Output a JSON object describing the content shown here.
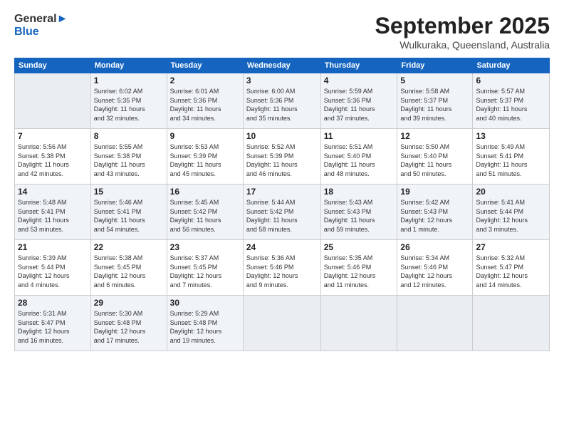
{
  "header": {
    "logo_line1": "General",
    "logo_line2": "Blue",
    "month": "September 2025",
    "location": "Wulkuraka, Queensland, Australia"
  },
  "weekdays": [
    "Sunday",
    "Monday",
    "Tuesday",
    "Wednesday",
    "Thursday",
    "Friday",
    "Saturday"
  ],
  "weeks": [
    [
      {
        "day": "",
        "info": ""
      },
      {
        "day": "1",
        "info": "Sunrise: 6:02 AM\nSunset: 5:35 PM\nDaylight: 11 hours\nand 32 minutes."
      },
      {
        "day": "2",
        "info": "Sunrise: 6:01 AM\nSunset: 5:36 PM\nDaylight: 11 hours\nand 34 minutes."
      },
      {
        "day": "3",
        "info": "Sunrise: 6:00 AM\nSunset: 5:36 PM\nDaylight: 11 hours\nand 35 minutes."
      },
      {
        "day": "4",
        "info": "Sunrise: 5:59 AM\nSunset: 5:36 PM\nDaylight: 11 hours\nand 37 minutes."
      },
      {
        "day": "5",
        "info": "Sunrise: 5:58 AM\nSunset: 5:37 PM\nDaylight: 11 hours\nand 39 minutes."
      },
      {
        "day": "6",
        "info": "Sunrise: 5:57 AM\nSunset: 5:37 PM\nDaylight: 11 hours\nand 40 minutes."
      }
    ],
    [
      {
        "day": "7",
        "info": "Sunrise: 5:56 AM\nSunset: 5:38 PM\nDaylight: 11 hours\nand 42 minutes."
      },
      {
        "day": "8",
        "info": "Sunrise: 5:55 AM\nSunset: 5:38 PM\nDaylight: 11 hours\nand 43 minutes."
      },
      {
        "day": "9",
        "info": "Sunrise: 5:53 AM\nSunset: 5:39 PM\nDaylight: 11 hours\nand 45 minutes."
      },
      {
        "day": "10",
        "info": "Sunrise: 5:52 AM\nSunset: 5:39 PM\nDaylight: 11 hours\nand 46 minutes."
      },
      {
        "day": "11",
        "info": "Sunrise: 5:51 AM\nSunset: 5:40 PM\nDaylight: 11 hours\nand 48 minutes."
      },
      {
        "day": "12",
        "info": "Sunrise: 5:50 AM\nSunset: 5:40 PM\nDaylight: 11 hours\nand 50 minutes."
      },
      {
        "day": "13",
        "info": "Sunrise: 5:49 AM\nSunset: 5:41 PM\nDaylight: 11 hours\nand 51 minutes."
      }
    ],
    [
      {
        "day": "14",
        "info": "Sunrise: 5:48 AM\nSunset: 5:41 PM\nDaylight: 11 hours\nand 53 minutes."
      },
      {
        "day": "15",
        "info": "Sunrise: 5:46 AM\nSunset: 5:41 PM\nDaylight: 11 hours\nand 54 minutes."
      },
      {
        "day": "16",
        "info": "Sunrise: 5:45 AM\nSunset: 5:42 PM\nDaylight: 11 hours\nand 56 minutes."
      },
      {
        "day": "17",
        "info": "Sunrise: 5:44 AM\nSunset: 5:42 PM\nDaylight: 11 hours\nand 58 minutes."
      },
      {
        "day": "18",
        "info": "Sunrise: 5:43 AM\nSunset: 5:43 PM\nDaylight: 11 hours\nand 59 minutes."
      },
      {
        "day": "19",
        "info": "Sunrise: 5:42 AM\nSunset: 5:43 PM\nDaylight: 12 hours\nand 1 minute."
      },
      {
        "day": "20",
        "info": "Sunrise: 5:41 AM\nSunset: 5:44 PM\nDaylight: 12 hours\nand 3 minutes."
      }
    ],
    [
      {
        "day": "21",
        "info": "Sunrise: 5:39 AM\nSunset: 5:44 PM\nDaylight: 12 hours\nand 4 minutes."
      },
      {
        "day": "22",
        "info": "Sunrise: 5:38 AM\nSunset: 5:45 PM\nDaylight: 12 hours\nand 6 minutes."
      },
      {
        "day": "23",
        "info": "Sunrise: 5:37 AM\nSunset: 5:45 PM\nDaylight: 12 hours\nand 7 minutes."
      },
      {
        "day": "24",
        "info": "Sunrise: 5:36 AM\nSunset: 5:46 PM\nDaylight: 12 hours\nand 9 minutes."
      },
      {
        "day": "25",
        "info": "Sunrise: 5:35 AM\nSunset: 5:46 PM\nDaylight: 12 hours\nand 11 minutes."
      },
      {
        "day": "26",
        "info": "Sunrise: 5:34 AM\nSunset: 5:46 PM\nDaylight: 12 hours\nand 12 minutes."
      },
      {
        "day": "27",
        "info": "Sunrise: 5:32 AM\nSunset: 5:47 PM\nDaylight: 12 hours\nand 14 minutes."
      }
    ],
    [
      {
        "day": "28",
        "info": "Sunrise: 5:31 AM\nSunset: 5:47 PM\nDaylight: 12 hours\nand 16 minutes."
      },
      {
        "day": "29",
        "info": "Sunrise: 5:30 AM\nSunset: 5:48 PM\nDaylight: 12 hours\nand 17 minutes."
      },
      {
        "day": "30",
        "info": "Sunrise: 5:29 AM\nSunset: 5:48 PM\nDaylight: 12 hours\nand 19 minutes."
      },
      {
        "day": "",
        "info": ""
      },
      {
        "day": "",
        "info": ""
      },
      {
        "day": "",
        "info": ""
      },
      {
        "day": "",
        "info": ""
      }
    ]
  ]
}
